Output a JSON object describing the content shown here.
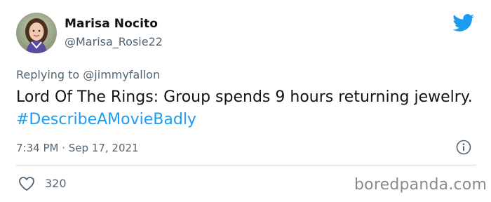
{
  "user": {
    "display_name": "Marisa Nocito",
    "handle": "@Marisa_Rosie22"
  },
  "reply": {
    "prefix": "Replying to ",
    "mention": "@jimmyfallon"
  },
  "tweet": {
    "text": "Lord Of The Rings: Group spends 9 hours returning jewelry. ",
    "hashtag": "#DescribeAMovieBadly",
    "timestamp": "7:34 PM · Sep 17, 2021"
  },
  "stats": {
    "likes": "320"
  },
  "watermark": "boredpanda.com",
  "icons": {
    "brand": "twitter-bird-icon",
    "info": "info-icon",
    "like": "heart-icon"
  },
  "colors": {
    "brand": "#1d9bf0",
    "text": "#0f1419",
    "muted": "#536471"
  }
}
